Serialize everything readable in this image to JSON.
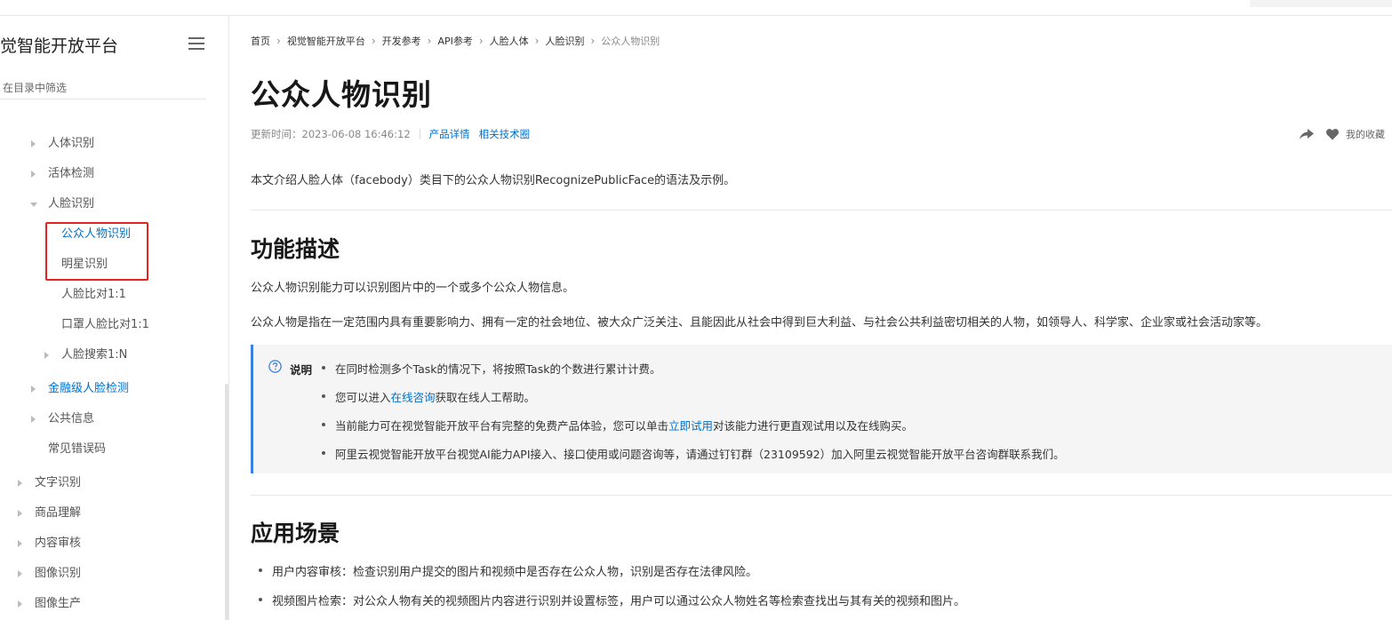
{
  "sidebar": {
    "title": "觉智能开放平台",
    "filter_placeholder": "在目录中筛选",
    "items": [
      {
        "label": "人体识别"
      },
      {
        "label": "活体检测"
      },
      {
        "label": "人脸识别"
      },
      {
        "label": "公众人物识别"
      },
      {
        "label": "明星识别"
      },
      {
        "label": "人脸比对1:1"
      },
      {
        "label": "口罩人脸比对1:1"
      },
      {
        "label": "人脸搜索1:N"
      },
      {
        "label": "金融级人脸检测"
      },
      {
        "label": "公共信息"
      },
      {
        "label": "常见错误码"
      },
      {
        "label": "文字识别"
      },
      {
        "label": "商品理解"
      },
      {
        "label": "内容审核"
      },
      {
        "label": "图像识别"
      },
      {
        "label": "图像生产"
      }
    ]
  },
  "breadcrumb": [
    "首页",
    "视觉智能开放平台",
    "开发参考",
    "API参考",
    "人脸人体",
    "人脸识别",
    "公众人物识别"
  ],
  "page": {
    "title": "公众人物识别",
    "updated": "更新时间：2023-06-08 16:46:12",
    "links": [
      "产品详情",
      "相关技术圈"
    ],
    "favorite_label": "我的收藏",
    "intro": "本文介绍人脸人体（facebody）类目下的公众人物识别RecognizePublicFace的语法及示例。"
  },
  "section1": {
    "heading": "功能描述",
    "p1": "公众人物识别能力可以识别图片中的一个或多个公众人物信息。",
    "p2": "公众人物是指在一定范围内具有重要影响力、拥有一定的社会地位、被大众广泛关注、且能因此从社会中得到巨大利益、与社会公共利益密切相关的人物，如领导人、科学家、企业家或社会活动家等。"
  },
  "note": {
    "label": "说明",
    "item1": "在同时检测多个Task的情况下，将按照Task的个数进行累计计费。",
    "item2_pre": "您可以进入",
    "item2_link": "在线咨询",
    "item2_post": "获取在线人工帮助。",
    "item3_pre": "当前能力可在视觉智能开放平台有完整的免费产品体验，您可以单击",
    "item3_link": "立即试用",
    "item3_post": "对该能力进行更直观试用以及在线购买。",
    "item4": "阿里云视觉智能开放平台视觉AI能力API接入、接口使用或问题咨询等，请通过钉钉群（23109592）加入阿里云视觉智能开放平台咨询群联系我们。"
  },
  "section2": {
    "heading": "应用场景",
    "items": [
      "用户内容审核：检查识别用户提交的图片和视频中是否存在公众人物，识别是否存在法律风险。",
      "视频图片检索：对公众人物有关的视频图片内容进行识别并设置标签，用户可以通过公众人物姓名等检索查找出与其有关的视频和图片。"
    ]
  },
  "colors": {
    "link": "#0070cc",
    "highlight": "#e8231f",
    "note_border": "#3b7fe0"
  }
}
